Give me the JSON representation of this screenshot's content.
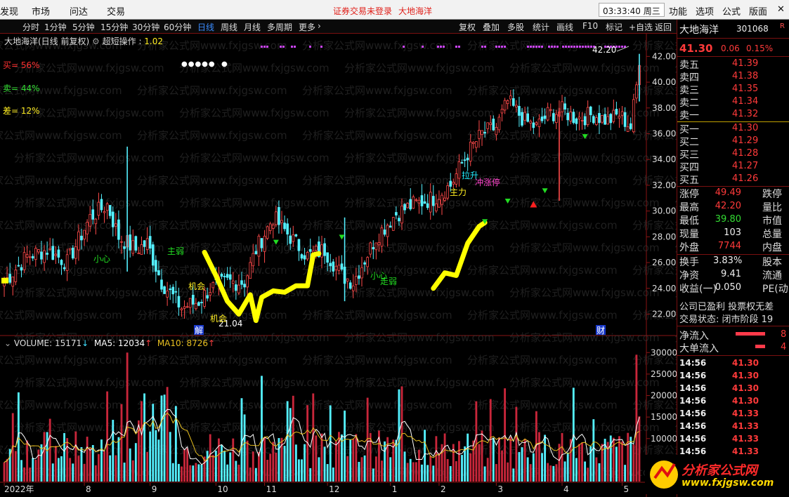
{
  "menubar": {
    "left_items": [
      "发现",
      "市场",
      "问达",
      "交易"
    ],
    "warning": "证券交易未登录",
    "stock_name": "大地海洋",
    "clock": "03:33:40 周三",
    "right_items": [
      "功能",
      "选项",
      "公式",
      "版面"
    ]
  },
  "toolbar": {
    "periods": [
      "分时",
      "1分钟",
      "5分钟",
      "15分钟",
      "30分钟",
      "60分钟",
      "日线",
      "周线",
      "月线",
      "多周期",
      "更多"
    ],
    "active_period": "日线",
    "tools": [
      "复权",
      "叠加",
      "多股",
      "统计",
      "画线",
      "F10",
      "标记",
      "+自选",
      "返回"
    ]
  },
  "chart_header": {
    "title": "大地海洋(日线 前复权)",
    "indicator": "超短操作",
    "indicator_value": "1.02",
    "buy_label": "买= 56%",
    "sell_label": "卖= 44%",
    "diff_label": "差= 12%"
  },
  "volume_header": {
    "label": "VOLUME: 15171",
    "ma5": "MA5: 12034",
    "ma10": "MA10: 8726"
  },
  "right_panel": {
    "name": "大地海洋",
    "code": "301068",
    "flag": "R",
    "price": "41.30",
    "change": "0.06",
    "pct": "0.15%",
    "asks": [
      {
        "label": "卖五",
        "price": "41.39"
      },
      {
        "label": "卖四",
        "price": "41.38"
      },
      {
        "label": "卖三",
        "price": "41.35"
      },
      {
        "label": "卖二",
        "price": "41.34"
      },
      {
        "label": "卖一",
        "price": "41.32"
      }
    ],
    "bids": [
      {
        "label": "买一",
        "price": "41.30"
      },
      {
        "label": "买二",
        "price": "41.29"
      },
      {
        "label": "买三",
        "price": "41.28"
      },
      {
        "label": "买四",
        "price": "41.27"
      },
      {
        "label": "买五",
        "price": "41.26"
      }
    ],
    "stats": [
      {
        "label": "涨停",
        "value": "49.49",
        "label2": "跌停",
        "color": "red"
      },
      {
        "label": "最高",
        "value": "42.20",
        "label2": "量比",
        "color": "red"
      },
      {
        "label": "最低",
        "value": "39.80",
        "label2": "市值",
        "color": "green"
      },
      {
        "label": "现量",
        "value": "103",
        "label2": "总量",
        "color": "white"
      },
      {
        "label": "外盘",
        "value": "7744",
        "label2": "内盘",
        "color": "red"
      }
    ],
    "stats2": [
      {
        "label": "换手",
        "value": "3.83%",
        "label2": "股本"
      },
      {
        "label": "净资",
        "value": "9.41",
        "label2": "流通"
      },
      {
        "label": "收益(一)",
        "value": "0.050",
        "label2": "PE(动"
      }
    ],
    "company_status": "公司已盈利 投票权无差",
    "trade_status": "交易状态: 闭市阶段 19",
    "net_inflow": "净流入",
    "big_inflow": "大单流入",
    "net_inflow_val": "8",
    "big_inflow_val": "4",
    "ticks": [
      {
        "time": "14:56",
        "price": "41.30"
      },
      {
        "time": "14:56",
        "price": "41.30"
      },
      {
        "time": "14:56",
        "price": "41.30"
      },
      {
        "time": "14:56",
        "price": "41.30"
      },
      {
        "time": "14:56",
        "price": "41.33"
      },
      {
        "time": "14:56",
        "price": "41.33"
      },
      {
        "time": "14:56",
        "price": "41.33"
      },
      {
        "time": "14:56",
        "price": "41.33"
      }
    ]
  },
  "logo": {
    "line1": "分析家公式网",
    "line2": "www.fxjgsw.com"
  },
  "watermark": "分析家公式网www.fxjgsw.com",
  "chart_data": {
    "type": "candlestick",
    "price_axis": [
      42.0,
      40.0,
      38.0,
      36.0,
      34.0,
      32.0,
      30.0,
      28.0,
      26.0,
      24.0,
      22.0
    ],
    "price_range": [
      20.5,
      43.0
    ],
    "volume_axis": [
      30000,
      25000,
      20000,
      15000,
      10000,
      5000
    ],
    "volume_range": [
      0,
      32000
    ],
    "x_ticks": [
      "2022年",
      "8",
      "9",
      "10",
      "11",
      "12",
      "1",
      "2",
      "3",
      "4",
      "5"
    ],
    "x_tick_index": [
      0,
      28,
      51,
      74,
      91,
      113,
      135,
      152,
      172,
      195,
      216
    ],
    "annotations": [
      {
        "text": "42.20",
        "price": 42.2
      },
      {
        "text": "21.04",
        "price": 21.04
      },
      {
        "text": "主弱",
        "price": 26.5
      },
      {
        "text": "小心",
        "price": 26.0
      },
      {
        "text": "机会",
        "price": 24.0
      },
      {
        "text": "机会",
        "price": 21.6
      },
      {
        "text": "小心",
        "price": 24.6
      },
      {
        "text": "走弱",
        "price": 24.0
      },
      {
        "text": "拉升",
        "price": 32.4
      },
      {
        "text": "主力",
        "price": 31.2
      },
      {
        "text": "冲涨停",
        "price": 32.0
      },
      {
        "text": "解",
        "price": 20.7
      },
      {
        "text": "财",
        "price": 20.7
      }
    ],
    "candles_seed": "daily OHLC May 2022 – May 2023; generated procedurally from anchor closes",
    "anchors": [
      [
        0,
        24.5
      ],
      [
        8,
        26.5
      ],
      [
        15,
        27.0
      ],
      [
        22,
        26.0
      ],
      [
        30,
        29.5
      ],
      [
        36,
        30.5
      ],
      [
        40,
        28.0
      ],
      [
        46,
        27.0
      ],
      [
        50,
        27.5
      ],
      [
        55,
        24.5
      ],
      [
        62,
        22.5
      ],
      [
        68,
        23.0
      ],
      [
        72,
        24.0
      ],
      [
        78,
        24.5
      ],
      [
        84,
        24.5
      ],
      [
        88,
        27.0
      ],
      [
        94,
        29.5
      ],
      [
        100,
        28.0
      ],
      [
        106,
        26.5
      ],
      [
        112,
        27.0
      ],
      [
        118,
        25.0
      ],
      [
        122,
        24.5
      ],
      [
        130,
        28.0
      ],
      [
        137,
        29.8
      ],
      [
        143,
        30.5
      ],
      [
        150,
        31.0
      ],
      [
        156,
        32.0
      ],
      [
        162,
        34.5
      ],
      [
        167,
        36.0
      ],
      [
        172,
        36.5
      ],
      [
        176,
        38.5
      ],
      [
        182,
        37.0
      ],
      [
        186,
        36.5
      ],
      [
        190,
        37.5
      ],
      [
        195,
        37.8
      ],
      [
        200,
        37.2
      ],
      [
        206,
        37.5
      ],
      [
        211,
        37.0
      ],
      [
        215,
        37.5
      ],
      [
        219,
        36.5
      ],
      [
        222,
        41.3
      ]
    ],
    "yellow_line": [
      [
        70,
        26.8
      ],
      [
        74,
        25.0
      ],
      [
        78,
        23.0
      ],
      [
        82,
        22.0
      ],
      [
        86,
        23.5
      ],
      [
        88,
        21.5
      ],
      [
        90,
        23.3
      ],
      [
        94,
        23.8
      ],
      [
        98,
        23.7
      ],
      [
        102,
        24.2
      ],
      [
        106,
        24.2
      ],
      [
        108,
        26.6
      ],
      [
        110,
        26.7
      ],
      [
        150,
        24.0
      ],
      [
        154,
        25.2
      ],
      [
        158,
        25.0
      ],
      [
        162,
        27.5
      ],
      [
        166,
        28.8
      ],
      [
        168,
        29.1
      ]
    ],
    "buy_arrows": [
      [
        95,
        27.6
      ],
      [
        118,
        28.0
      ],
      [
        168,
        29.2
      ],
      [
        176,
        30.8
      ],
      [
        189,
        31.6
      ],
      [
        203,
        35.8
      ]
    ],
    "red_arrow": [
      185,
      30.5
    ]
  }
}
